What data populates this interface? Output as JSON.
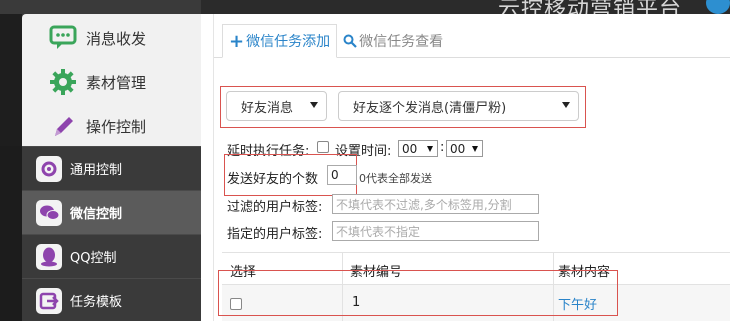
{
  "header": {
    "app_title": "云控移动营销平台"
  },
  "sidebar": {
    "top_items": [
      {
        "label": "消息收发",
        "icon": "chat-bubble-icon"
      },
      {
        "label": "素材管理",
        "icon": "gear-icon"
      },
      {
        "label": "操作控制",
        "icon": "pen-icon"
      }
    ],
    "items": [
      {
        "label": "通用控制",
        "icon": "settings-icon",
        "active": false
      },
      {
        "label": "微信控制",
        "icon": "wechat-icon",
        "active": true
      },
      {
        "label": "QQ控制",
        "icon": "qq-icon",
        "active": false
      },
      {
        "label": "任务模板",
        "icon": "template-icon",
        "active": false
      }
    ]
  },
  "tabs": [
    {
      "label": "微信任务添加",
      "icon": "plus-icon",
      "active": true
    },
    {
      "label": "微信任务查看",
      "icon": "search-icon",
      "active": false
    }
  ],
  "form": {
    "type_select": "好友消息",
    "action_select": "好友逐个发消息(清僵尸粉)",
    "delay_label": "延时执行任务:",
    "set_time_label": "设置时间:",
    "hour_value": "00",
    "minute_value": "00",
    "time_separator": ":",
    "send_count_label": "发送好友的个数",
    "send_count_value": "0",
    "send_count_hint": "0代表全部发送",
    "filter_tag_label": "过滤的用户标签:",
    "filter_tag_placeholder": "不填代表不过滤,多个标签用,分割",
    "target_tag_label": "指定的用户标签:",
    "target_tag_placeholder": "不填代表不指定"
  },
  "table": {
    "columns": [
      "选择",
      "素材编号",
      "素材内容"
    ],
    "rows": [
      {
        "id": "1",
        "content": "下午好"
      }
    ]
  },
  "colors": {
    "accent": "#2a84c9",
    "highlight_box": "#d9534f",
    "sidebar_bg": "#3a3a3a"
  }
}
